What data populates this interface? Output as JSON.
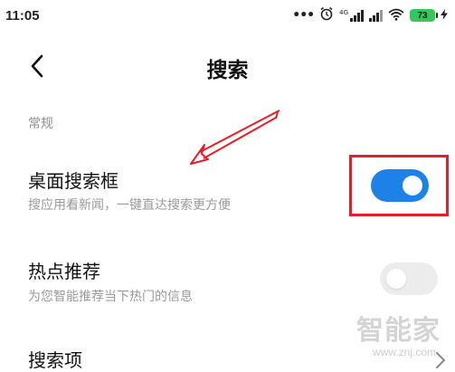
{
  "status_bar": {
    "time": "11:05",
    "dots": "•••",
    "network_tag": "4G",
    "battery_level": "73",
    "icons": [
      "alarm-icon",
      "signal-icon",
      "signal-icon",
      "wifi-icon",
      "battery-icon",
      "charging-icon"
    ]
  },
  "header": {
    "title": "搜索",
    "back_icon": "chevron-left-icon"
  },
  "section": {
    "label": "常规"
  },
  "settings": [
    {
      "title": "桌面搜索框",
      "description": "搜应用看新闻，一键直达搜索更方便",
      "enabled": true
    },
    {
      "title": "热点推荐",
      "description": "为您智能推荐当下热门的信息",
      "enabled": false
    },
    {
      "title": "搜索项",
      "description": ""
    }
  ],
  "colors": {
    "toggle_on": "#1c82e8",
    "toggle_off": "#ececec",
    "annotation_red": "#e41f2a"
  },
  "watermark": {
    "title": "智能家",
    "url": "www.znj.com"
  }
}
